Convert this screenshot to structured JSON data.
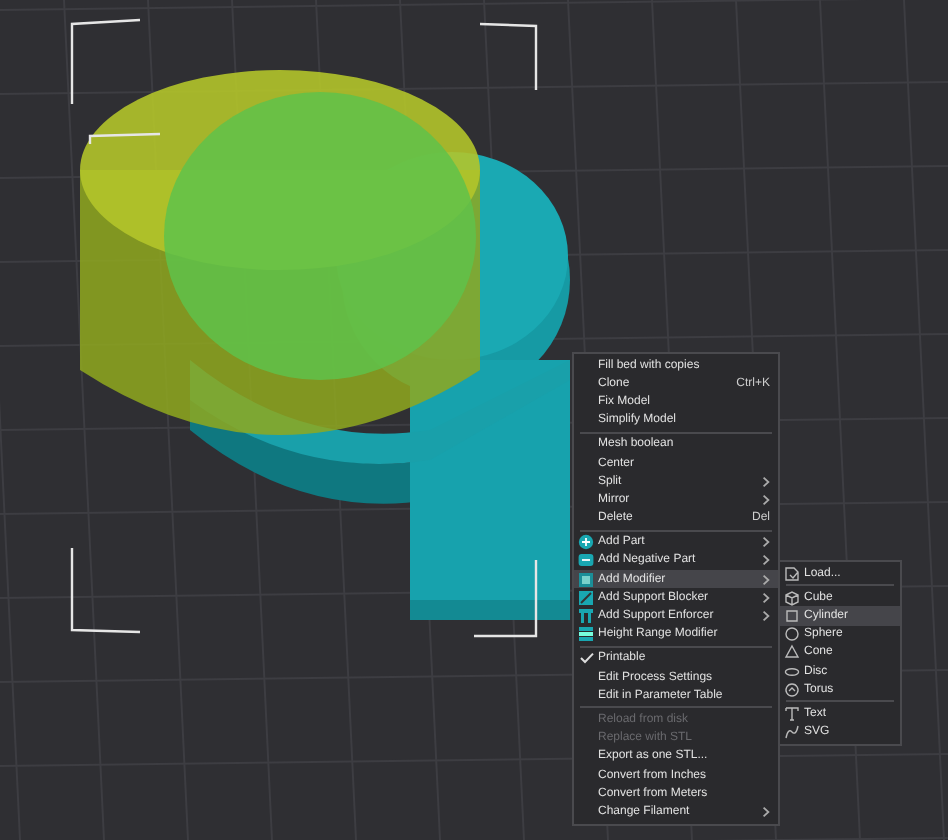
{
  "context_menu": {
    "groups": [
      [
        {
          "label": "Fill bed with copies",
          "kind": "plain",
          "submenu": false,
          "selected": false,
          "disabled": false,
          "checked": false
        },
        {
          "label": "Clone",
          "shortcut": "Ctrl+K",
          "kind": "plain",
          "submenu": false,
          "selected": false,
          "disabled": false,
          "checked": false
        },
        {
          "label": "Fix Model",
          "kind": "plain",
          "submenu": false,
          "selected": false,
          "disabled": false,
          "checked": false
        },
        {
          "label": "Simplify Model",
          "kind": "plain",
          "submenu": false,
          "selected": false,
          "disabled": false,
          "checked": false
        }
      ],
      [
        {
          "label": "Mesh boolean",
          "kind": "plain",
          "submenu": false,
          "selected": false,
          "disabled": false,
          "checked": false
        },
        {
          "label": "Center",
          "kind": "plain",
          "submenu": false,
          "selected": false,
          "disabled": false,
          "checked": false
        },
        {
          "label": "Split",
          "kind": "plain",
          "submenu": true,
          "selected": false,
          "disabled": false,
          "checked": false
        },
        {
          "label": "Mirror",
          "kind": "plain",
          "submenu": true,
          "selected": false,
          "disabled": false,
          "checked": false
        },
        {
          "label": "Delete",
          "shortcut": "Del",
          "kind": "plain",
          "submenu": false,
          "selected": false,
          "disabled": false,
          "checked": false
        }
      ],
      [
        {
          "label": "Add Part",
          "kind": "add-part",
          "submenu": true,
          "selected": false,
          "disabled": false,
          "checked": false
        },
        {
          "label": "Add Negative Part",
          "kind": "add-negative",
          "submenu": true,
          "selected": false,
          "disabled": false,
          "checked": false
        },
        {
          "label": "Add Modifier",
          "kind": "add-modifier",
          "submenu": true,
          "selected": true,
          "disabled": false,
          "checked": false
        },
        {
          "label": "Add Support Blocker",
          "kind": "support-blocker",
          "submenu": true,
          "selected": false,
          "disabled": false,
          "checked": false
        },
        {
          "label": "Add Support Enforcer",
          "kind": "support-enforcer",
          "submenu": true,
          "selected": false,
          "disabled": false,
          "checked": false
        },
        {
          "label": "Height Range Modifier",
          "kind": "height-range",
          "submenu": false,
          "selected": false,
          "disabled": false,
          "checked": false
        }
      ],
      [
        {
          "label": "Printable",
          "kind": "plain",
          "submenu": false,
          "selected": false,
          "disabled": false,
          "checked": true
        },
        {
          "label": "Edit Process Settings",
          "kind": "plain",
          "submenu": false,
          "selected": false,
          "disabled": false,
          "checked": false
        },
        {
          "label": "Edit in Parameter Table",
          "kind": "plain",
          "submenu": false,
          "selected": false,
          "disabled": false,
          "checked": false
        }
      ],
      [
        {
          "label": "Reload from disk",
          "kind": "plain",
          "submenu": false,
          "selected": false,
          "disabled": true,
          "checked": false
        },
        {
          "label": "Replace with STL",
          "kind": "plain",
          "submenu": false,
          "selected": false,
          "disabled": true,
          "checked": false
        },
        {
          "label": "Export as one STL...",
          "kind": "plain",
          "submenu": false,
          "selected": false,
          "disabled": false,
          "checked": false
        },
        {
          "label": "Convert from Inches",
          "kind": "plain",
          "submenu": false,
          "selected": false,
          "disabled": false,
          "checked": false
        },
        {
          "label": "Convert from Meters",
          "kind": "plain",
          "submenu": false,
          "selected": false,
          "disabled": false,
          "checked": false
        },
        {
          "label": "Change Filament",
          "kind": "plain",
          "submenu": true,
          "selected": false,
          "disabled": false,
          "checked": false
        }
      ]
    ]
  },
  "submenu": {
    "groups": [
      [
        {
          "label": "Load...",
          "kind": "load",
          "selected": false
        }
      ],
      [
        {
          "label": "Cube",
          "kind": "cube",
          "selected": false
        },
        {
          "label": "Cylinder",
          "kind": "cylinder",
          "selected": true
        },
        {
          "label": "Sphere",
          "kind": "sphere",
          "selected": false
        },
        {
          "label": "Cone",
          "kind": "cone",
          "selected": false
        },
        {
          "label": "Disc",
          "kind": "disc",
          "selected": false
        },
        {
          "label": "Torus",
          "kind": "torus",
          "selected": false
        }
      ],
      [
        {
          "label": "Text",
          "kind": "text",
          "selected": false
        },
        {
          "label": "SVG",
          "kind": "svg",
          "selected": false
        }
      ]
    ]
  }
}
